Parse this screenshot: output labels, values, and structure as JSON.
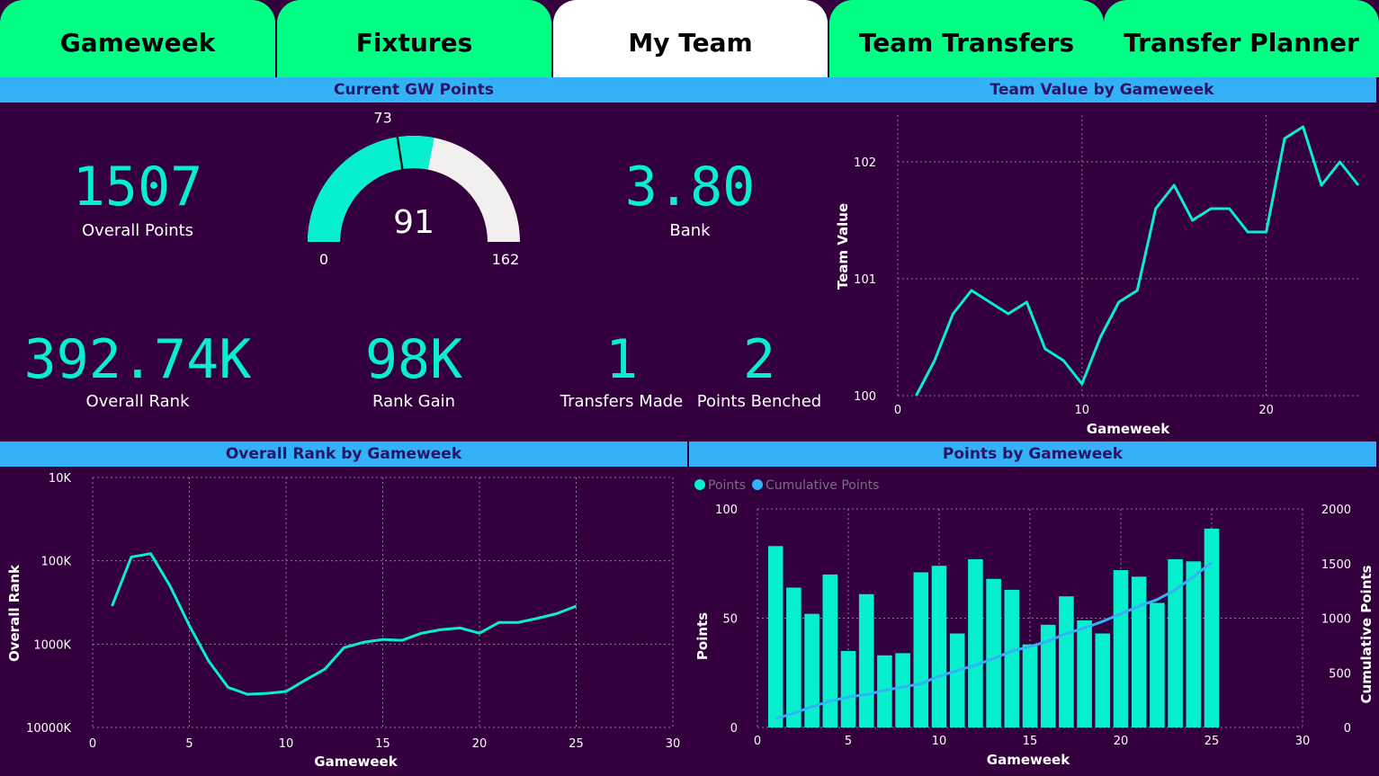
{
  "tabs": [
    {
      "label": "Gameweek"
    },
    {
      "label": "Fixtures"
    },
    {
      "label": "My Team"
    },
    {
      "label": "Team Transfers"
    },
    {
      "label": "Transfer Planner"
    }
  ],
  "sections": {
    "current_gw": "Current GW Points",
    "team_value": "Team Value by Gameweek",
    "overall_rank": "Overall Rank by Gameweek",
    "points": "Points by Gameweek"
  },
  "kpis": {
    "overall_points": {
      "value": "1507",
      "label": "Overall Points"
    },
    "bank": {
      "value": "3.80",
      "label": "Bank"
    },
    "overall_rank": {
      "value": "392.74K",
      "label": "Overall Rank"
    },
    "rank_gain": {
      "value": "98K",
      "label": "Rank Gain"
    },
    "transfers_made": {
      "value": "1",
      "label": "Transfers Made"
    },
    "points_benched": {
      "value": "2",
      "label": "Points Benched"
    }
  },
  "colors": {
    "background": "#33003d",
    "tab": "#00ff85",
    "tab_active": "#ffffff",
    "section_bar": "#34b1f7",
    "accent": "#06f0ce",
    "cumulative": "#34b1f7",
    "gauge_track": "#f2f0ef"
  },
  "chart_data": [
    {
      "type": "gauge",
      "value": 91,
      "min": 0,
      "max": 162,
      "target": 73,
      "value_label": "91",
      "min_label": "0",
      "max_label": "162",
      "target_label": "73"
    },
    {
      "type": "line",
      "title": "Team Value by Gameweek",
      "xlabel": "Gameweek",
      "ylabel": "Team Value",
      "x": [
        1,
        2,
        3,
        4,
        5,
        6,
        7,
        8,
        9,
        10,
        11,
        12,
        13,
        14,
        15,
        16,
        17,
        18,
        19,
        20,
        21,
        22,
        23,
        24,
        25
      ],
      "values": [
        100.0,
        100.3,
        100.7,
        100.9,
        100.8,
        100.7,
        100.8,
        100.4,
        100.3,
        100.1,
        100.5,
        100.8,
        100.9,
        101.6,
        101.8,
        101.5,
        101.6,
        101.6,
        101.4,
        101.4,
        102.2,
        102.3,
        101.8,
        102.0,
        101.8
      ],
      "xlim": [
        0,
        25
      ],
      "ylim": [
        100,
        102.4
      ],
      "xticks": [
        0,
        10,
        20
      ],
      "xtick_labels": [
        "0",
        "10",
        "20"
      ],
      "yticks": [
        100,
        101,
        102
      ],
      "ytick_labels": [
        "100",
        "101",
        "102"
      ],
      "grid": true
    },
    {
      "type": "line",
      "title": "Overall Rank by Gameweek",
      "xlabel": "Gameweek",
      "ylabel": "Overall Rank",
      "log_scale_y": true,
      "reversed_y": true,
      "x": [
        1,
        2,
        3,
        4,
        5,
        6,
        7,
        8,
        9,
        10,
        11,
        12,
        13,
        14,
        15,
        16,
        17,
        18,
        19,
        20,
        21,
        22,
        23,
        24,
        25
      ],
      "values": [
        350000,
        90000,
        82000,
        200000,
        600000,
        1600000,
        3300000,
        4000000,
        3900000,
        3700000,
        2700000,
        2000000,
        1100000,
        950000,
        880000,
        900000,
        740000,
        670000,
        640000,
        740000,
        550000,
        550000,
        490000,
        430000,
        350000
      ],
      "xlim": [
        0,
        30
      ],
      "ylim": [
        10000,
        10000000
      ],
      "xticks": [
        0,
        5,
        10,
        15,
        20,
        25,
        30
      ],
      "xtick_labels": [
        "0",
        "5",
        "10",
        "15",
        "20",
        "25",
        "30"
      ],
      "yticks": [
        10000,
        100000,
        1000000,
        10000000
      ],
      "ytick_labels": [
        "10K",
        "100K",
        "1000K",
        "10000K"
      ],
      "grid": true
    },
    {
      "type": "bar",
      "title": "Points by Gameweek",
      "xlabel": "Gameweek",
      "ylabel": "Points",
      "y2label": "Cumulative Points",
      "legend_placement": "top-left",
      "x": [
        1,
        2,
        3,
        4,
        5,
        6,
        7,
        8,
        9,
        10,
        11,
        12,
        13,
        14,
        15,
        16,
        17,
        18,
        19,
        20,
        21,
        22,
        23,
        24,
        25
      ],
      "series": [
        {
          "name": "Points",
          "kind": "bar",
          "axis": "left",
          "values": [
            83,
            64,
            52,
            70,
            35,
            61,
            33,
            34,
            71,
            74,
            43,
            77,
            68,
            63,
            38,
            47,
            60,
            49,
            43,
            72,
            69,
            57,
            77,
            76,
            91
          ]
        },
        {
          "name": "Cumulative Points",
          "kind": "line",
          "axis": "right",
          "values": [
            80,
            130,
            190,
            240,
            280,
            300,
            340,
            370,
            400,
            470,
            520,
            570,
            630,
            700,
            740,
            790,
            860,
            910,
            970,
            1040,
            1110,
            1170,
            1260,
            1380,
            1510
          ]
        }
      ],
      "xlim": [
        0,
        30
      ],
      "ylim": [
        0,
        100
      ],
      "y2lim": [
        0,
        2000
      ],
      "xticks": [
        0,
        5,
        10,
        15,
        20,
        25,
        30
      ],
      "xtick_labels": [
        "0",
        "5",
        "10",
        "15",
        "20",
        "25",
        "30"
      ],
      "yticks": [
        0,
        50,
        100
      ],
      "ytick_labels": [
        "0",
        "50",
        "100"
      ],
      "y2ticks": [
        0,
        500,
        1000,
        1500,
        2000
      ],
      "y2tick_labels": [
        "0",
        "500",
        "1000",
        "1500",
        "2000"
      ],
      "grid": true
    }
  ]
}
